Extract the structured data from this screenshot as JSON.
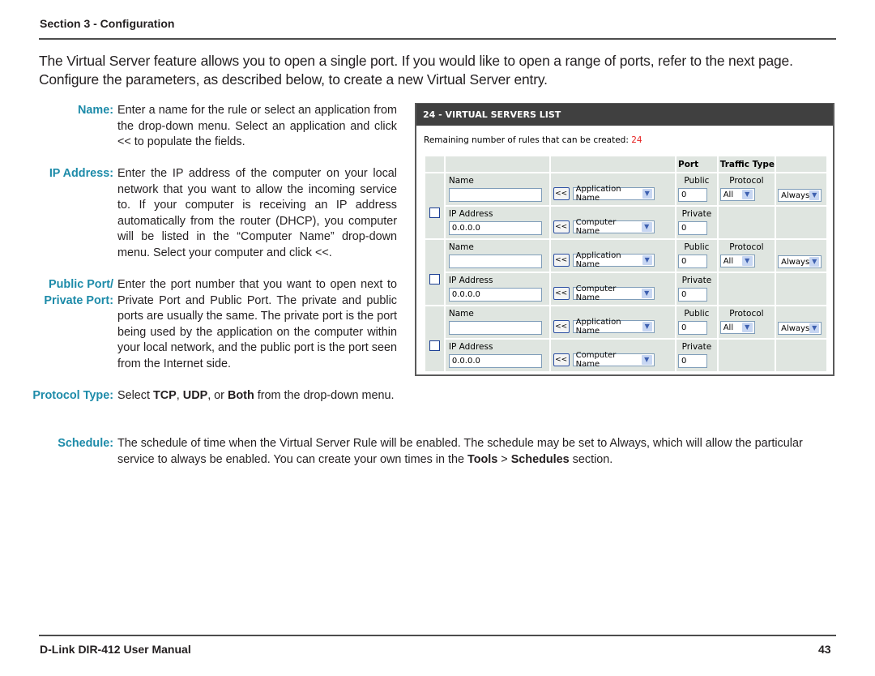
{
  "header": {
    "section_title": "Section 3 - Configuration"
  },
  "intro": "The Virtual Server feature allows you to open a single port. If you would like to open a range of ports, refer to the next page. Configure the parameters, as described below, to create a new Virtual Server entry.",
  "terms": {
    "name": {
      "label": "Name:",
      "desc": "Enter a name for the rule or select an application from the drop-down menu. Select an application and click << to populate the fields."
    },
    "ip": {
      "label": "IP Address:",
      "desc": "Enter the IP address of the computer on your local network that you want to allow the incoming service to. If your computer is receiving an IP address automatically from the router (DHCP), you computer will be listed in the “Computer Name” drop-down menu. Select your computer and click <<."
    },
    "ports": {
      "label_1": "Public Port/",
      "label_2": "Private Port:",
      "desc": "Enter the port number that you want to open next to Private Port and Public Port. The private and public ports are usually the same. The private port is the port being used by the application on the computer within your local network, and the public port is the port seen from the Internet side."
    },
    "protocol": {
      "label": "Protocol Type:",
      "desc_1": "Select ",
      "tcp": "TCP",
      "sep1": ", ",
      "udp": "UDP",
      "sep2": ", or ",
      "both": "Both",
      "desc_2": " from the drop-down menu."
    },
    "schedule": {
      "label": "Schedule:",
      "desc_1": "The schedule of time when the Virtual Server Rule will be enabled. The schedule may be set to Always, which will allow the particular service to always be enabled. You can create your own times in the ",
      "tools": "Tools",
      "sep": " > ",
      "schedules": "Schedules",
      "desc_2": " section."
    }
  },
  "panel": {
    "title": "24 - VIRTUAL SERVERS LIST",
    "remaining_label": "Remaining number of rules that can be created: ",
    "remaining_count": "24",
    "col_port": "Port",
    "col_traffic": "Traffic Type",
    "back_label": "<<",
    "rules": [
      {
        "name_label": "Name",
        "name_value": "",
        "app_select": "Application Name",
        "public_label": "Public",
        "public_value": "0",
        "protocol_label": "Protocol",
        "protocol_value": "All",
        "schedule_value": "Always",
        "ip_label": "IP Address",
        "ip_value": "0.0.0.0",
        "computer_select": "Computer Name",
        "private_label": "Private",
        "private_value": "0"
      },
      {
        "name_label": "Name",
        "name_value": "",
        "app_select": "Application Name",
        "public_label": "Public",
        "public_value": "0",
        "protocol_label": "Protocol",
        "protocol_value": "All",
        "schedule_value": "Always",
        "ip_label": "IP Address",
        "ip_value": "0.0.0.0",
        "computer_select": "Computer Name",
        "private_label": "Private",
        "private_value": "0"
      },
      {
        "name_label": "Name",
        "name_value": "",
        "app_select": "Application Name",
        "public_label": "Public",
        "public_value": "0",
        "protocol_label": "Protocol",
        "protocol_value": "All",
        "schedule_value": "Always",
        "ip_label": "IP Address",
        "ip_value": "0.0.0.0",
        "computer_select": "Computer Name",
        "private_label": "Private",
        "private_value": "0"
      }
    ]
  },
  "footer": {
    "manual": "D-Link DIR-412 User Manual",
    "page": "43"
  }
}
